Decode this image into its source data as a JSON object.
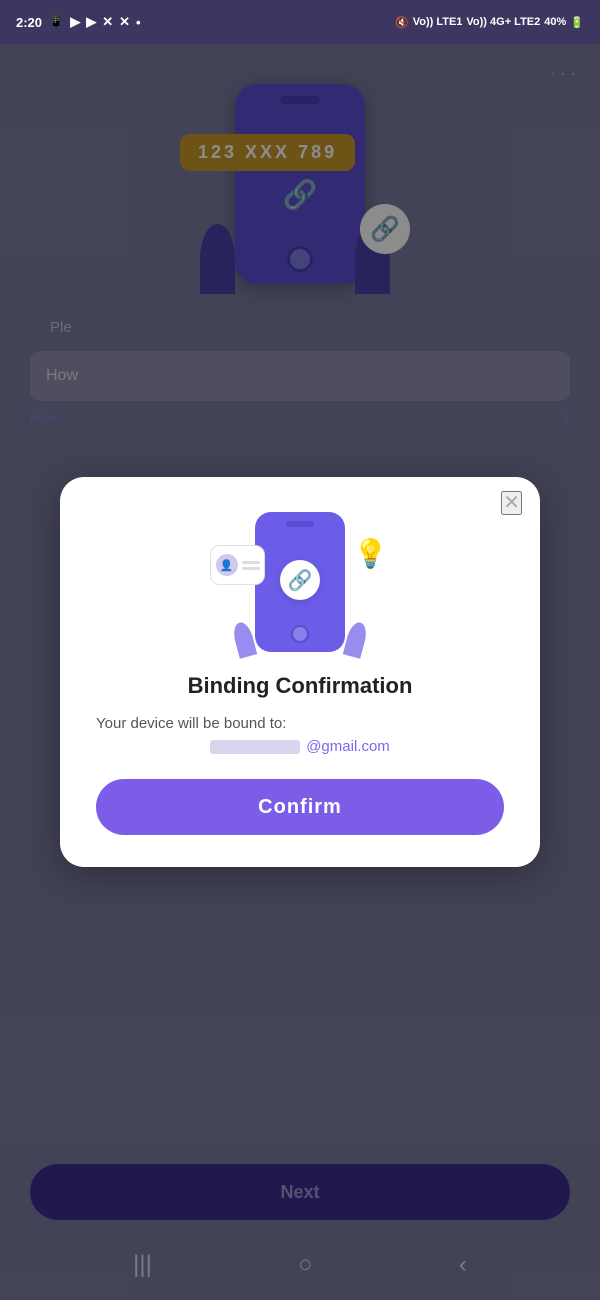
{
  "status_bar": {
    "time": "2:20",
    "battery": "40%"
  },
  "header": {
    "three_dots": "···"
  },
  "background": {
    "phone_number": "123 XXX 789",
    "placeholder_text": "Ple",
    "link_text": "How",
    "number_2": "2",
    "next_button_label": "Next"
  },
  "modal": {
    "close_label": "✕",
    "title": "Binding Confirmation",
    "body_text": "Your device will be bound to:",
    "email_suffix": "@gmail.com",
    "confirm_label": "Confirm"
  },
  "bottom_nav": {
    "back": "‹",
    "home": "○",
    "menu": "|||"
  }
}
